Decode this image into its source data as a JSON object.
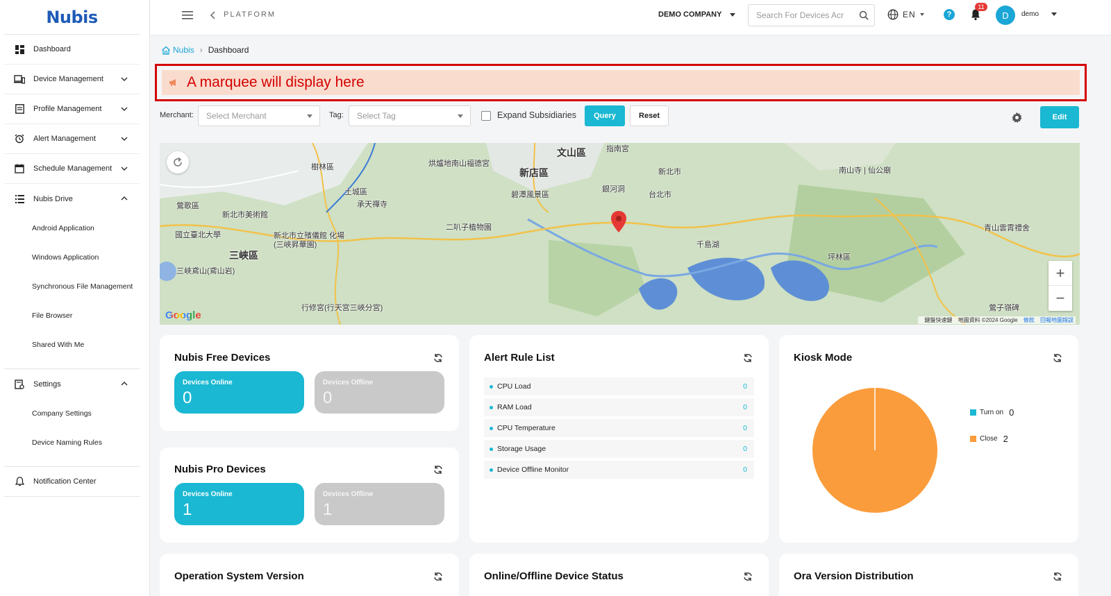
{
  "brand": {
    "logo_text": "Nubis"
  },
  "sidebar": {
    "items": [
      {
        "label": "Dashboard"
      },
      {
        "label": "Device Management"
      },
      {
        "label": "Profile Management"
      },
      {
        "label": "Alert Management"
      },
      {
        "label": "Schedule Management"
      },
      {
        "label": "Nubis Drive"
      },
      {
        "label": "Settings"
      },
      {
        "label": "Notification Center"
      }
    ],
    "drive_sub": [
      "Android Application",
      "Windows Application",
      "Synchronous File Management",
      "File Browser",
      "Shared With Me"
    ],
    "settings_sub": [
      "Company Settings",
      "Device Naming Rules"
    ]
  },
  "topbar": {
    "platform": "PLATFORM",
    "company": "DEMO COMPANY",
    "search_placeholder": "Search For Devices Acr",
    "language": "EN",
    "help": "?",
    "notification_count": "11",
    "avatar_letter": "D",
    "username": "demo"
  },
  "breadcrumb": {
    "home": "Nubis",
    "current": "Dashboard"
  },
  "marquee": {
    "text": "A marquee will display here"
  },
  "filters": {
    "merchant_label": "Merchant:",
    "merchant_placeholder": "Select Merchant",
    "tag_label": "Tag:",
    "tag_placeholder": "Select Tag",
    "expand_label": "Expand Subsidiaries",
    "query_label": "Query",
    "reset_label": "Reset",
    "edit_label": "Edit"
  },
  "map": {
    "labels": [
      "文山區",
      "新店區",
      "指南宮",
      "樹林區",
      "土城區",
      "承天禪寺",
      "烘爐地南山福德宮",
      "碧潭風景區",
      "銀河洞",
      "新北市",
      "台北市",
      "南山寺 | 仙公廟",
      "鶯歌區",
      "新北市美術館",
      "國立臺北大學",
      "新北市立殯儀館 化場(三峽昇華園)",
      "二叭子植物園",
      "千島湖",
      "坪林區",
      "青山雲霄禮舍",
      "三峽區",
      "三峽鳶山(鳶山岩)",
      "行修宮(行天宮三峽分宮)",
      "鶯子嶺碑"
    ],
    "google": "Google",
    "attribution": [
      "鍵盤快速鍵",
      "地圖資料 ©2024 Google",
      "條款",
      "回報地圖錯誤"
    ]
  },
  "cards": {
    "free": {
      "title": "Nubis Free Devices",
      "online_label": "Devices Online",
      "online_value": "0",
      "offline_label": "Devices Offline",
      "offline_value": "0"
    },
    "pro": {
      "title": "Nubis Pro Devices",
      "online_label": "Devices Online",
      "online_value": "1",
      "offline_label": "Devices Offline",
      "offline_value": "1"
    },
    "alert": {
      "title": "Alert Rule List",
      "rows": [
        {
          "name": "CPU Load",
          "value": "0"
        },
        {
          "name": "RAM Load",
          "value": "0"
        },
        {
          "name": "CPU Temperature",
          "value": "0"
        },
        {
          "name": "Storage Usage",
          "value": "0"
        },
        {
          "name": "Device Offline Monitor",
          "value": "0"
        }
      ]
    },
    "kiosk": {
      "title": "Kiosk Mode",
      "legend": [
        {
          "label": "Turn on",
          "value": "0",
          "color": "#1ab8d2"
        },
        {
          "label": "Close",
          "value": "2",
          "color": "#fb9c3c"
        }
      ]
    },
    "os": {
      "title": "Operation System Version"
    },
    "status": {
      "title": "Online/Offline Device Status"
    },
    "ora": {
      "title": "Ora Version Distribution"
    }
  },
  "chart_data": {
    "type": "pie",
    "title": "Kiosk Mode",
    "categories": [
      "Turn on",
      "Close"
    ],
    "values": [
      0,
      2
    ],
    "colors": [
      "#1ab8d2",
      "#fb9c3c"
    ]
  },
  "colors": {
    "accent": "#1ab8d2",
    "marquee_bg": "#fadcce",
    "marquee_text": "#d40000"
  }
}
